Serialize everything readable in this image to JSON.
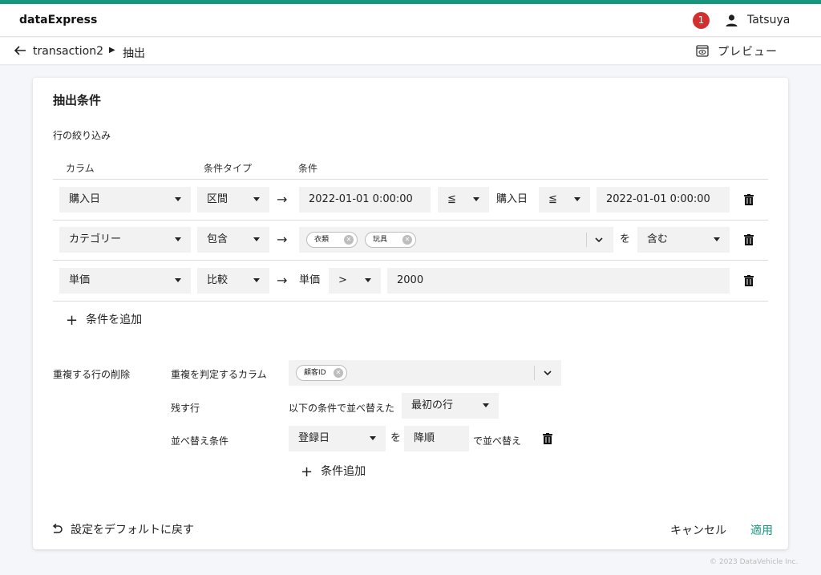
{
  "app": {
    "name": "dataExpress",
    "notification_count": "1",
    "user_name": "Tatsuya"
  },
  "breadcrumb": {
    "parent": "transaction2",
    "current": "抽出"
  },
  "toolbar": {
    "preview_label": "プレビュー"
  },
  "card": {
    "title": "抽出条件",
    "row_filter_label": "行の絞り込み",
    "columns": {
      "column": "カラム",
      "condition_type": "条件タイプ",
      "condition": "条件"
    },
    "rows": [
      {
        "column": "購入日",
        "type": "区間",
        "from": "2022-01-01 0:00:00",
        "op1": "≦",
        "mid_label": "購入日",
        "op2": "≦",
        "to": "2022-01-01 0:00:00"
      },
      {
        "column": "カテゴリー",
        "type": "包含",
        "chips": [
          "衣類",
          "玩具"
        ],
        "wo": "を",
        "mode": "含む"
      },
      {
        "column": "単価",
        "type": "比較",
        "target": "単価",
        "op": ">",
        "value": "2000"
      }
    ],
    "add_condition": "条件を追加",
    "dedupe": {
      "label": "重複する行の削除",
      "key_columns_label": "重複を判定するカラム",
      "key_chips": [
        "顧客ID"
      ],
      "keep_label": "残す行",
      "keep_prefix": "以下の条件で並べ替えた",
      "keep_value": "最初の行",
      "sort_label": "並べ替え条件",
      "sort_column": "登録日",
      "sort_wo": "を",
      "sort_order": "降順",
      "sort_suffix": "で並べ替え",
      "add_sort": "条件追加"
    },
    "reset_label": "設定をデフォルトに戻す",
    "cancel_label": "キャンセル",
    "apply_label": "適用"
  },
  "footer": {
    "copyright": "© 2023 DataVehicle Inc."
  },
  "colors": {
    "accent": "#14967f",
    "badge": "#d32f2f"
  }
}
